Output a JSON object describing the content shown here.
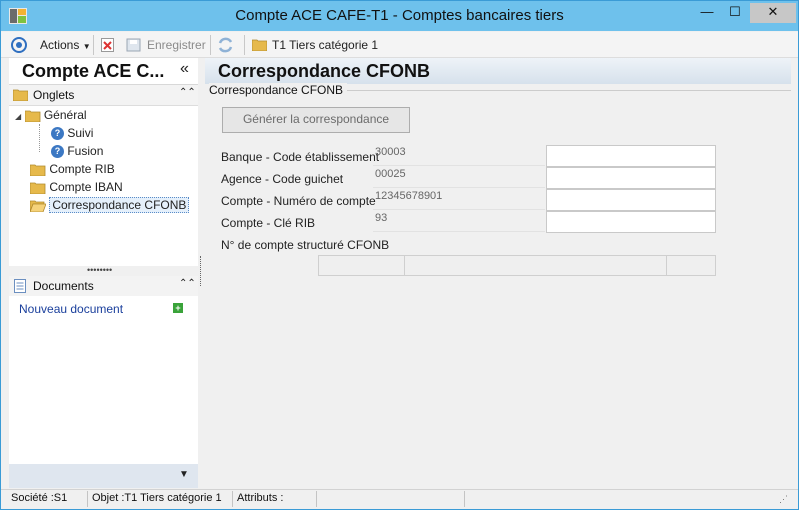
{
  "window": {
    "title": "Compte ACE CAFE-T1 -  Comptes bancaires tiers",
    "min_symbol": "—",
    "max_symbol": "☐",
    "close_symbol": "✕"
  },
  "toolbar": {
    "actions_label": "Actions",
    "save_label": "Enregistrer",
    "context_label": "T1 Tiers catégorie 1"
  },
  "left_panel": {
    "title": "Compte ACE C...",
    "collapse_symbol": "«",
    "tabs_header": "Onglets",
    "tree": {
      "general": "Général",
      "suivi": "Suivi",
      "fusion": "Fusion",
      "rib": "Compte RIB",
      "iban": "Compte IBAN",
      "cfonb": "Correspondance CFONB"
    },
    "documents_header": "Documents",
    "new_document": "Nouveau document"
  },
  "main": {
    "title": "Correspondance CFONB",
    "section_label": "Correspondance CFONB",
    "generate_button": "Générer la correspondance",
    "fields": [
      {
        "label": "Banque - Code établissement",
        "value": "30003"
      },
      {
        "label": "Agence - Code guichet",
        "value": "00025"
      },
      {
        "label": "Compte - Numéro de compte",
        "value": "12345678901"
      },
      {
        "label": "Compte - Clé RIB",
        "value": "93"
      }
    ],
    "structured_label": "N° de compte structuré CFONB"
  },
  "status": {
    "societe": "Société :S1",
    "objet": "Objet :T1 Tiers catégorie 1",
    "attributs": "Attributs :"
  },
  "colors": {
    "titlebar": "#6ec1ec",
    "link": "#1a3f9c"
  }
}
